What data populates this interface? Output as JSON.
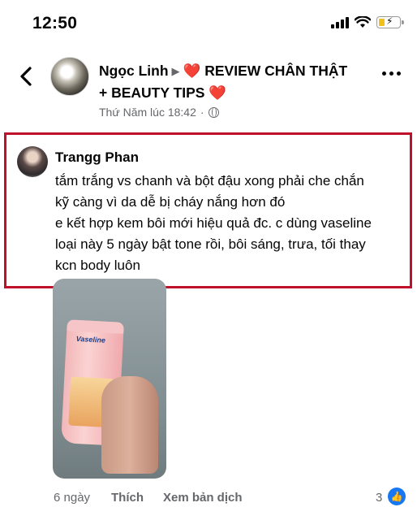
{
  "status_bar": {
    "time": "12:50"
  },
  "post_header": {
    "author": "Ngọc Linh",
    "group_name": "REVIEW CHÂN THẬT + BEAUTY TIPS",
    "timestamp": "Thứ Năm lúc 18:42",
    "privacy_icon": "globe-icon",
    "heart_color": "#e0202e"
  },
  "comment": {
    "author": "Trangg Phan",
    "lines": [
      "tắm trắng vs chanh và bột đậu xong phải che chắn",
      "kỹ càng vì da dễ bị cháy nắng hơn đó",
      "e kết hợp kem bôi mới hiệu quả đc. c dùng vaseline",
      "loại này 5 ngày bật tone rồi, bôi sáng, trưa, tối thay",
      "kcn body luôn"
    ],
    "highlight_color": "#c0112a"
  },
  "photo": {
    "product_brand": "Vaseline"
  },
  "actions": {
    "time_ago": "6 ngày",
    "like": "Thích",
    "translate": "Xem bản dịch",
    "reaction_count": "3",
    "reaction_icon": "like-icon"
  }
}
